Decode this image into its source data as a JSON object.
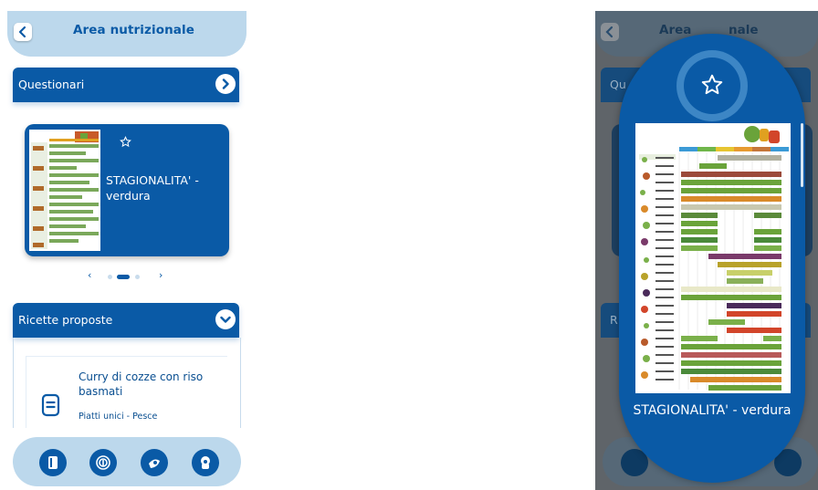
{
  "app": {
    "title": "Area nutrizionale"
  },
  "sections": {
    "questionari": {
      "title": "Questionari"
    },
    "ricette": {
      "title": "Ricette proposte"
    }
  },
  "quiz_card": {
    "title": "STAGIONALITA' - verdura"
  },
  "recipe": {
    "name": "Curry di cozze con riso basmati",
    "category": "Piatti unici - Pesce"
  },
  "overlay": {
    "title_left": "Area",
    "title_right": "nale",
    "section_q": "Qu",
    "section_r": "R",
    "image_title": "STAGIONALITA' - verdura"
  },
  "icons": {
    "back": "chevron-left-icon",
    "expand": "chevron-right-icon",
    "collapse": "chevron-down-icon",
    "favorite": "star-outline-icon",
    "recipe": "document-icon",
    "nav": [
      "book-icon",
      "fingerprint-icon",
      "food-icon",
      "chef-icon"
    ]
  },
  "colors": {
    "primary": "#0a5aa6",
    "light": "#bcd8ec",
    "dimmed_bg": "#5f6469"
  }
}
